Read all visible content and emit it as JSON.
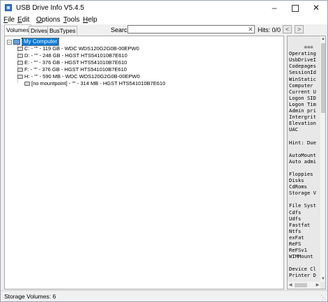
{
  "window": {
    "title": "USB Drive Info V5.4.5"
  },
  "menu": [
    {
      "key": "F",
      "rest": "ile"
    },
    {
      "key": "E",
      "rest": "dit"
    },
    {
      "key": "O",
      "rest": "ptions"
    },
    {
      "key": "T",
      "rest": "ools"
    },
    {
      "key": "H",
      "rest": "elp"
    }
  ],
  "tabs": [
    "Volumes",
    "Drives",
    "BusTypes"
  ],
  "search": {
    "label": "Search:",
    "value": "",
    "clear_glyph": "✕",
    "hits": "Hits:  0/0",
    "prev": "<",
    "next": ">"
  },
  "tree": {
    "root": "My Computer",
    "items": [
      "C: - \"\" - 119 GB - WDC WDS120G2G0B-00EPW0",
      "D: - \"\" - 248 GB - HGST HTS541010B7E610",
      "E: - \"\" - 376 GB - HGST HTS541010B7E610",
      "F: - \"\" - 376 GB - HGST HTS541010B7E610",
      "H: - \"\" - 590 MB - WDC WDS120G2G0B-00EPW0",
      "[no mountpoint] - \"\" - 314 MB - HGST HTS541010B7E610"
    ]
  },
  "details": {
    "lines": [
      "",
      "     ===",
      "Operating",
      "UsbDriveI",
      "Codepages",
      "SessionId",
      "WinStatic",
      "Computer",
      "Current U",
      "Logon SID",
      "Logon Tim",
      "Admin pri",
      "Intergrit",
      "Elevation",
      "UAC",
      "",
      "Hint: Due",
      "",
      "AutoMount",
      "Auto admi",
      "",
      "Floppies",
      "Disks",
      "CdRoms",
      "Storage V",
      "",
      "File Syst",
      "Cdfs",
      "Udfs",
      "Fastfat",
      "Ntfs",
      "exFat",
      "ReFS",
      "ReFSv1",
      "WIMMount",
      "",
      "Device Cl",
      "Printer D"
    ]
  },
  "status": {
    "text": "Storage Volumes: 6"
  }
}
